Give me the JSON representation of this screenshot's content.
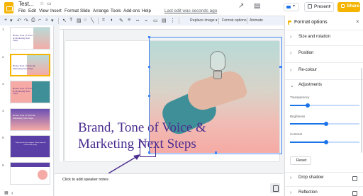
{
  "header": {
    "doc_title": "Test...",
    "menu": [
      "File",
      "Edit",
      "View",
      "Insert",
      "Format",
      "Slide",
      "Arrange",
      "Tools",
      "Add-ons",
      "Help"
    ],
    "last_edit": "Last edit was seconds ago",
    "present_label": "Present",
    "share_label": "Share"
  },
  "toolbar": {
    "replace_image": "Replace image ▾",
    "format_options": "Format options",
    "animate": "Animate"
  },
  "filmstrip": {
    "slide_numbers": [
      "1",
      "2",
      "3",
      "4",
      "5",
      "6"
    ],
    "active_index": 2,
    "thumb_title": "Brand, Tone of Voice & Marketing Next Steps",
    "thumb_body": "Thank you for your support. Please keep the conversation going."
  },
  "slide": {
    "title": "Brand, Tone of Voice & Marketing Next Steps"
  },
  "speaker_notes": {
    "placeholder": "Click to add speaker notes"
  },
  "format_panel": {
    "title": "Format options",
    "sections": [
      {
        "label": "Size and rotation",
        "expanded": false
      },
      {
        "label": "Position",
        "expanded": false
      },
      {
        "label": "Re-colour",
        "expanded": false
      },
      {
        "label": "Adjustments",
        "expanded": true
      }
    ],
    "adjustments": {
      "transparency_label": "Transparency",
      "transparency_value": 0.25,
      "brightness_label": "Brightness",
      "brightness_value": 0.52,
      "contrast_label": "Contrast",
      "contrast_value": 0.52
    },
    "reset_label": "Reset",
    "drop_shadow_label": "Drop shadow",
    "reflection_label": "Reflection"
  },
  "colors": {
    "accent": "#f4b400",
    "selection": "#4285f4",
    "title_text": "#4b2d8f",
    "slider": "#1a73e8"
  },
  "icons": [
    "slides-logo-icon",
    "star-icon",
    "move-to-folder-icon",
    "activity-icon",
    "comment-icon",
    "meet-icon",
    "present-icon",
    "lock-icon",
    "close-icon",
    "chevron-icon",
    "explore-icon",
    "grid-view-icon"
  ]
}
